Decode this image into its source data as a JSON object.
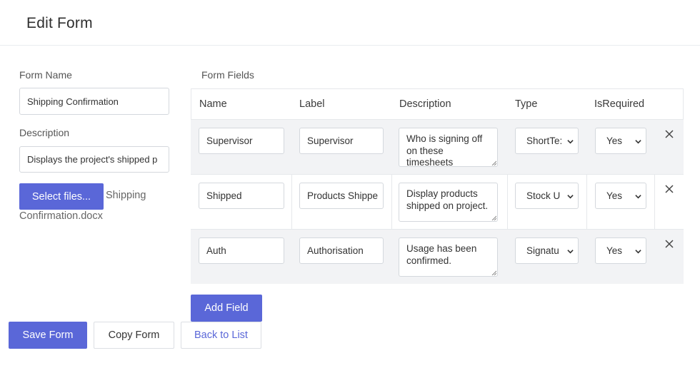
{
  "page": {
    "title": "Edit Form"
  },
  "form": {
    "name_label": "Form Name",
    "name_value": "Shipping Confirmation",
    "description_label": "Description",
    "description_value": "Displays the project's shipped p",
    "select_files_label": "Select files...",
    "file_name_line1": "Shipping",
    "file_name_line2": "Confirmation.docx"
  },
  "fields": {
    "section_label": "Form Fields",
    "columns": [
      "Name",
      "Label",
      "Description",
      "Type",
      "IsRequired"
    ],
    "rows": [
      {
        "name": "Supervisor",
        "label": "Supervisor",
        "description": "Who is signing off on these timesheets",
        "type": "ShortTe:",
        "required": "Yes"
      },
      {
        "name": "Shipped",
        "label": "Products Shippe",
        "description": "Display products shipped on project.",
        "type": "Stock U",
        "required": "Yes"
      },
      {
        "name": "Auth",
        "label": "Authorisation",
        "description": "Usage has been confirmed.",
        "type": "Signatu",
        "required": "Yes"
      }
    ],
    "add_field_label": "Add Field"
  },
  "actions": {
    "save_label": "Save Form",
    "copy_label": "Copy Form",
    "back_label": "Back to List"
  },
  "colors": {
    "primary": "#5a67d8",
    "link": "#5a67d8",
    "row_shade": "#f2f3f5",
    "border": "#e6e8eb"
  },
  "icons": {
    "remove": "close-icon",
    "select_caret": "chevron-down-icon",
    "textarea_grip": "resize-grip-icon"
  }
}
